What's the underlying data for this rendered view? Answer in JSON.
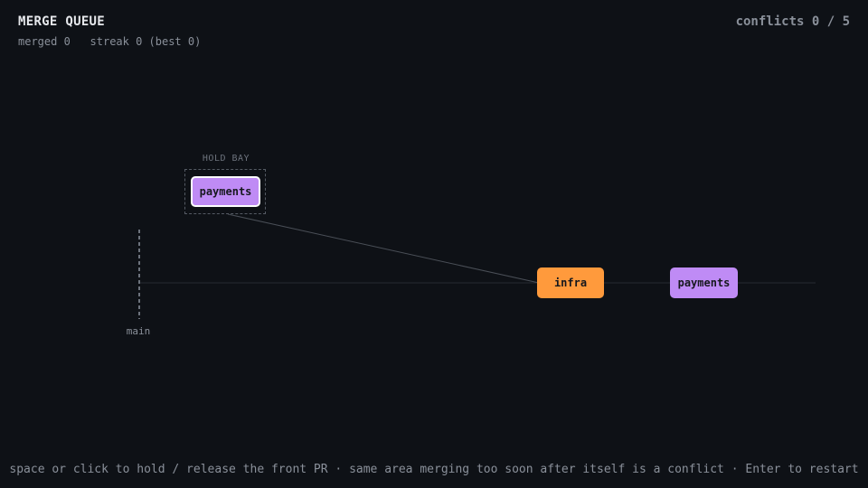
{
  "header": {
    "title": "MERGE QUEUE",
    "merged_label": "merged",
    "merged_value": "0",
    "streak_text": "streak 0 (best 0)",
    "conflicts_text": "conflicts 0 / 5"
  },
  "hold_bay": {
    "label": "HOLD BAY",
    "pr": {
      "area": "payments",
      "color": "#bf8bf5"
    }
  },
  "queue": [
    {
      "area": "infra",
      "color": "#ff9a3c"
    },
    {
      "area": "payments",
      "color": "#bf8bf5"
    }
  ],
  "main": {
    "label": "main"
  },
  "footer": {
    "hint": "space or click to hold / release the front PR · same area merging too soon after itself is a conflict · Enter to restart"
  }
}
